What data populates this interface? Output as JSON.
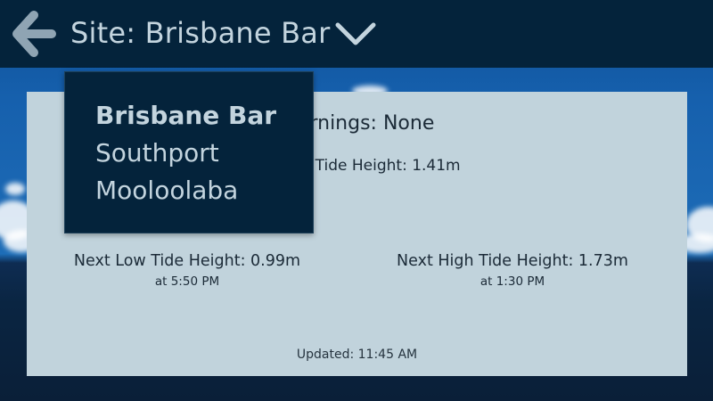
{
  "header": {
    "title": "Site: Brisbane Bar",
    "back_icon": "back-arrow-icon",
    "dropdown_icon": "chevron-down-icon"
  },
  "colors": {
    "header_bg": "#04233b",
    "header_text": "#c3d4de",
    "card_bg": "#c1d3dc",
    "card_text": "#1b2a37"
  },
  "card": {
    "warnings": "Warnings: None",
    "current_tide": "Current Tide Height: 1.41m",
    "next_low": {
      "height": "Next Low Tide Height: 0.99m",
      "time": "at 5:50 PM"
    },
    "next_high": {
      "height": "Next High Tide Height: 1.73m",
      "time": "at 1:30 PM"
    },
    "updated": "Updated: 11:45 AM"
  },
  "dropdown": {
    "items": [
      {
        "label": "Brisbane Bar",
        "selected": true
      },
      {
        "label": "Southport",
        "selected": false
      },
      {
        "label": "Mooloolaba",
        "selected": false
      }
    ]
  }
}
